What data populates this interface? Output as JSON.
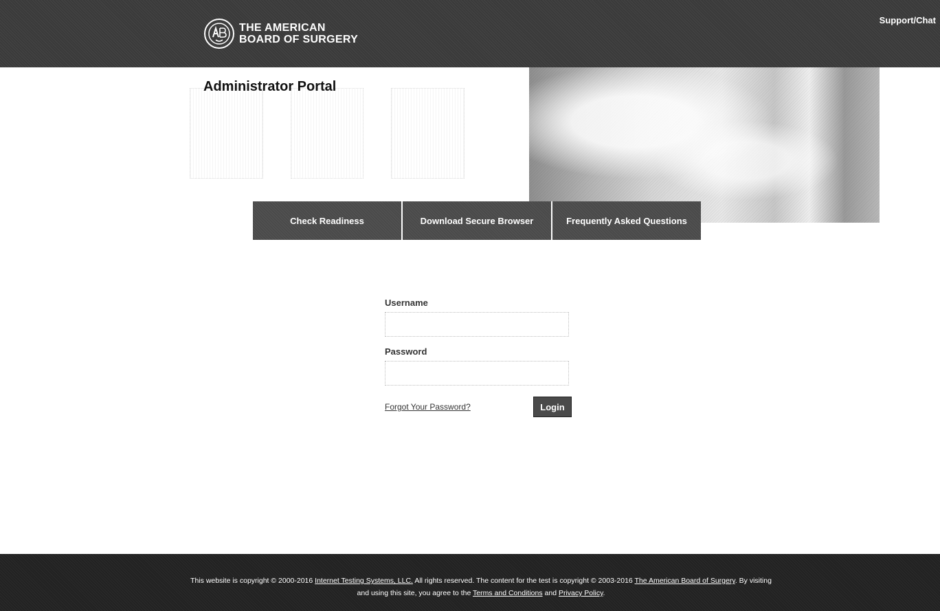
{
  "header": {
    "logo_line1": "THE AMERICAN",
    "logo_line2": "BOARD OF SURGERY",
    "support_label": "Support/Chat"
  },
  "banner": {
    "title": "Administrator Portal",
    "nav": {
      "check_readiness": "Check Readiness",
      "download_browser": "Download Secure Browser",
      "faq": "Frequently Asked Questions"
    }
  },
  "login": {
    "username_label": "Username",
    "username_value": "",
    "password_label": "Password",
    "password_value": "",
    "forgot_label": "Forgot Your Password?",
    "login_label": "Login"
  },
  "footer": {
    "text1": "This website is copyright © 2000-2016",
    "link_its": "Internet Testing Systems, LLC.",
    "text2": "All rights reserved. The content for the test is copyright © 2003-2016",
    "link_abs": "The American Board of Surgery",
    "text3": ". By visiting and using this site, you agree to the",
    "link_terms": "Terms and Conditions",
    "text4": "and",
    "link_privacy": "Privacy Policy",
    "text5": "."
  },
  "colors": {
    "header_bg": "#3a3a3a",
    "nav_button_bg": "#4a4a4a",
    "footer_bg": "#222222"
  }
}
